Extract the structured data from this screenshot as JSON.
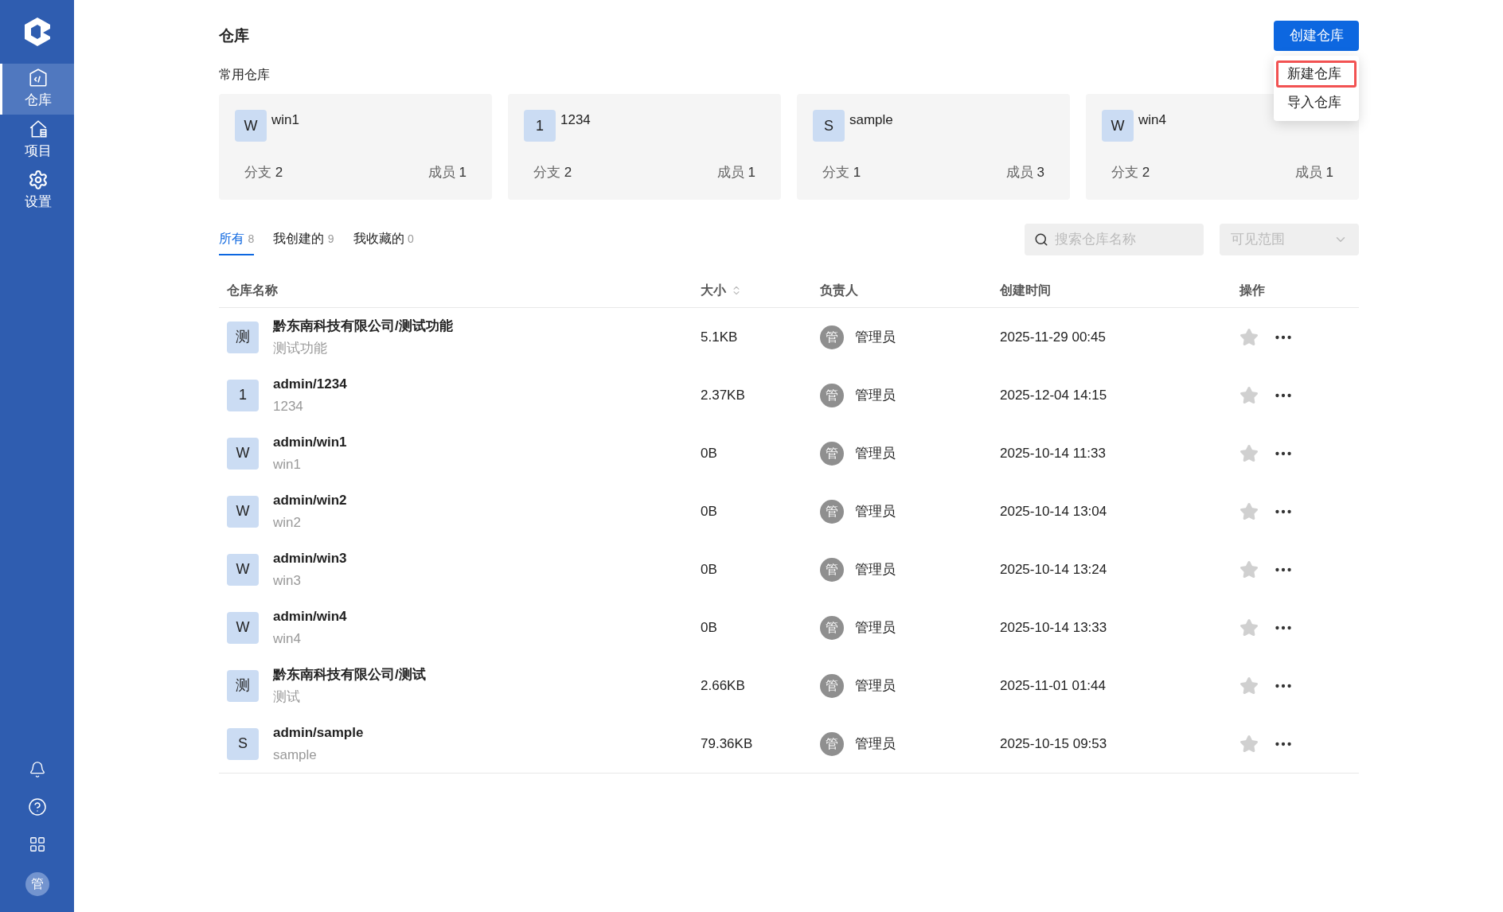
{
  "sidebar": {
    "items": [
      {
        "kind": "repo",
        "label": "仓库",
        "selected": true
      },
      {
        "kind": "project",
        "label": "项目",
        "selected": false
      },
      {
        "kind": "settings",
        "label": "设置",
        "selected": false
      }
    ],
    "avatar": "管"
  },
  "page": {
    "title": "仓库",
    "create_button": "创建仓库",
    "menu": [
      {
        "label": "新建仓库",
        "highlighted": true
      },
      {
        "label": "导入仓库",
        "highlighted": false
      }
    ]
  },
  "favorites": {
    "title": "常用仓库",
    "cards": [
      {
        "initial": "W",
        "name": "win1",
        "branches_label": "分支",
        "branches": "2",
        "members_label": "成员",
        "members": "1"
      },
      {
        "initial": "1",
        "name": "1234",
        "branches_label": "分支",
        "branches": "2",
        "members_label": "成员",
        "members": "1"
      },
      {
        "initial": "S",
        "name": "sample",
        "branches_label": "分支",
        "branches": "1",
        "members_label": "成员",
        "members": "3"
      },
      {
        "initial": "W",
        "name": "win4",
        "branches_label": "分支",
        "branches": "2",
        "members_label": "成员",
        "members": "1"
      }
    ]
  },
  "tabs": [
    {
      "label": "所有",
      "count": "8",
      "selected": true
    },
    {
      "label": "我创建的",
      "count": "9",
      "selected": false
    },
    {
      "label": "我收藏的",
      "count": "0",
      "selected": false
    }
  ],
  "search": {
    "placeholder": "搜索仓库名称"
  },
  "scope": {
    "placeholder": "可见范围"
  },
  "table": {
    "columns": [
      "仓库名称",
      "大小",
      "负责人",
      "创建时间",
      "操作"
    ],
    "rows": [
      {
        "initial": "测",
        "path": "黔东南科技有限公司/测试功能",
        "name": "测试功能",
        "size": "5.1KB",
        "owner_initial": "管",
        "owner": "管理员",
        "created": "2025-11-29 00:45",
        "starred": false
      },
      {
        "initial": "1",
        "path": "admin/1234",
        "name": "1234",
        "size": "2.37KB",
        "owner_initial": "管",
        "owner": "管理员",
        "created": "2025-12-04 14:15",
        "starred": false
      },
      {
        "initial": "W",
        "path": "admin/win1",
        "name": "win1",
        "size": "0B",
        "owner_initial": "管",
        "owner": "管理员",
        "created": "2025-10-14 11:33",
        "starred": false
      },
      {
        "initial": "W",
        "path": "admin/win2",
        "name": "win2",
        "size": "0B",
        "owner_initial": "管",
        "owner": "管理员",
        "created": "2025-10-14 13:04",
        "starred": false
      },
      {
        "initial": "W",
        "path": "admin/win3",
        "name": "win3",
        "size": "0B",
        "owner_initial": "管",
        "owner": "管理员",
        "created": "2025-10-14 13:24",
        "starred": false
      },
      {
        "initial": "W",
        "path": "admin/win4",
        "name": "win4",
        "size": "0B",
        "owner_initial": "管",
        "owner": "管理员",
        "created": "2025-10-14 13:33",
        "starred": false
      },
      {
        "initial": "测",
        "path": "黔东南科技有限公司/测试",
        "name": "测试",
        "size": "2.66KB",
        "owner_initial": "管",
        "owner": "管理员",
        "created": "2025-11-01 01:44",
        "starred": false
      },
      {
        "initial": "S",
        "path": "admin/sample",
        "name": "sample",
        "size": "79.36KB",
        "owner_initial": "管",
        "owner": "管理员",
        "created": "2025-10-15 09:53",
        "starred": false
      }
    ]
  }
}
